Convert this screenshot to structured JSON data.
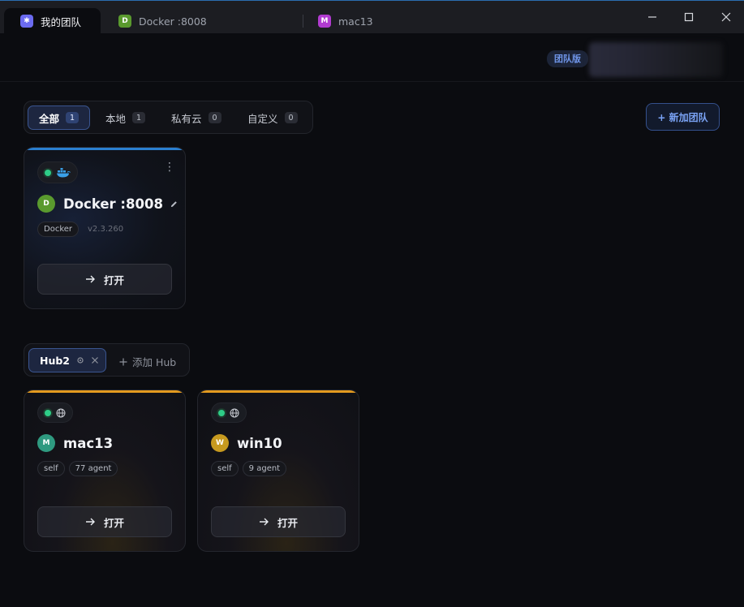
{
  "titlebar": {
    "tabs": [
      {
        "label": "我的团队",
        "icon": "✱",
        "icon_color": "#6b6bf0"
      },
      {
        "label": "Docker :8008",
        "icon": "D",
        "icon_color": "#5a9a2e"
      },
      {
        "label": "mac13",
        "icon": "M",
        "icon_color": "#b13bd0"
      }
    ]
  },
  "header": {
    "badge": "团队版"
  },
  "filters": {
    "tabs": [
      {
        "label": "全部",
        "count": "1"
      },
      {
        "label": "本地",
        "count": "1"
      },
      {
        "label": "私有云",
        "count": "0"
      },
      {
        "label": "自定义",
        "count": "0"
      }
    ],
    "add_team": "+ 新加团队"
  },
  "local_cards": [
    {
      "avatar": "D",
      "avatar_color": "#5a9a2e",
      "title": "Docker :8008",
      "tag": "Docker",
      "version": "v2.3.260",
      "open_label": "打开",
      "accent": "#2a7fd0",
      "type_icon": "docker-icon"
    }
  ],
  "hub": {
    "tab": "Hub2",
    "add_label": "添加 Hub"
  },
  "hub_cards": [
    {
      "avatar": "M",
      "avatar_color": "#2f9a80",
      "title": "mac13",
      "tags": [
        "self",
        "77 agent"
      ],
      "open_label": "打开",
      "accent": "#e39a1f",
      "type_icon": "globe-icon"
    },
    {
      "avatar": "W",
      "avatar_color": "#c79a1f",
      "title": "win10",
      "tags": [
        "self",
        "9 agent"
      ],
      "open_label": "打开",
      "accent": "#e39a1f",
      "type_icon": "globe-icon"
    }
  ]
}
